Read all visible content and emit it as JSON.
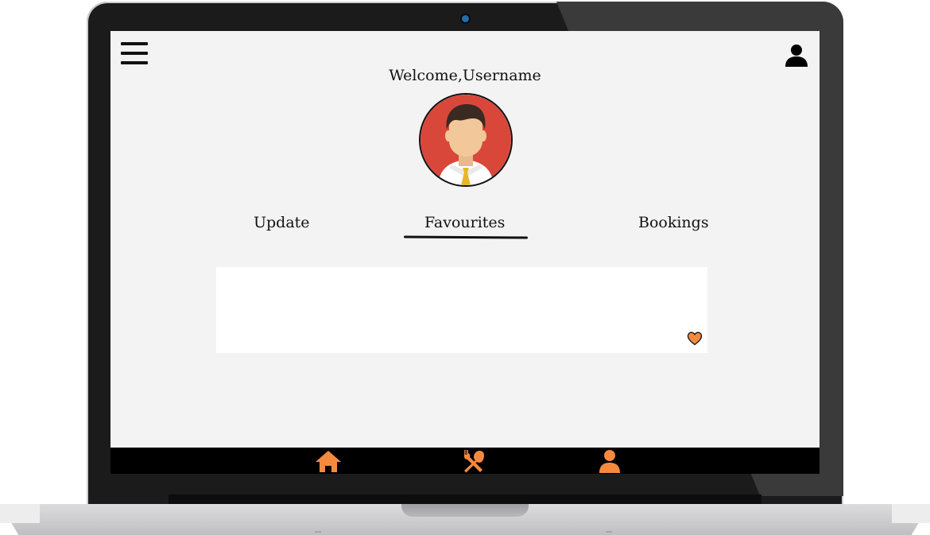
{
  "header": {
    "welcome_text": "Welcome,Username"
  },
  "tabs": [
    {
      "label": "Update"
    },
    {
      "label": "Favourites",
      "active": true
    },
    {
      "label": "Bookings"
    }
  ],
  "bottom_nav": [
    {
      "icon": "home-icon"
    },
    {
      "icon": "utensils-icon"
    },
    {
      "icon": "person-icon"
    }
  ],
  "colors": {
    "accent": "#f58a3f",
    "screen_bg": "#f3f3f3",
    "nav_bg": "#000000",
    "avatar_bg": "#d9473a"
  }
}
